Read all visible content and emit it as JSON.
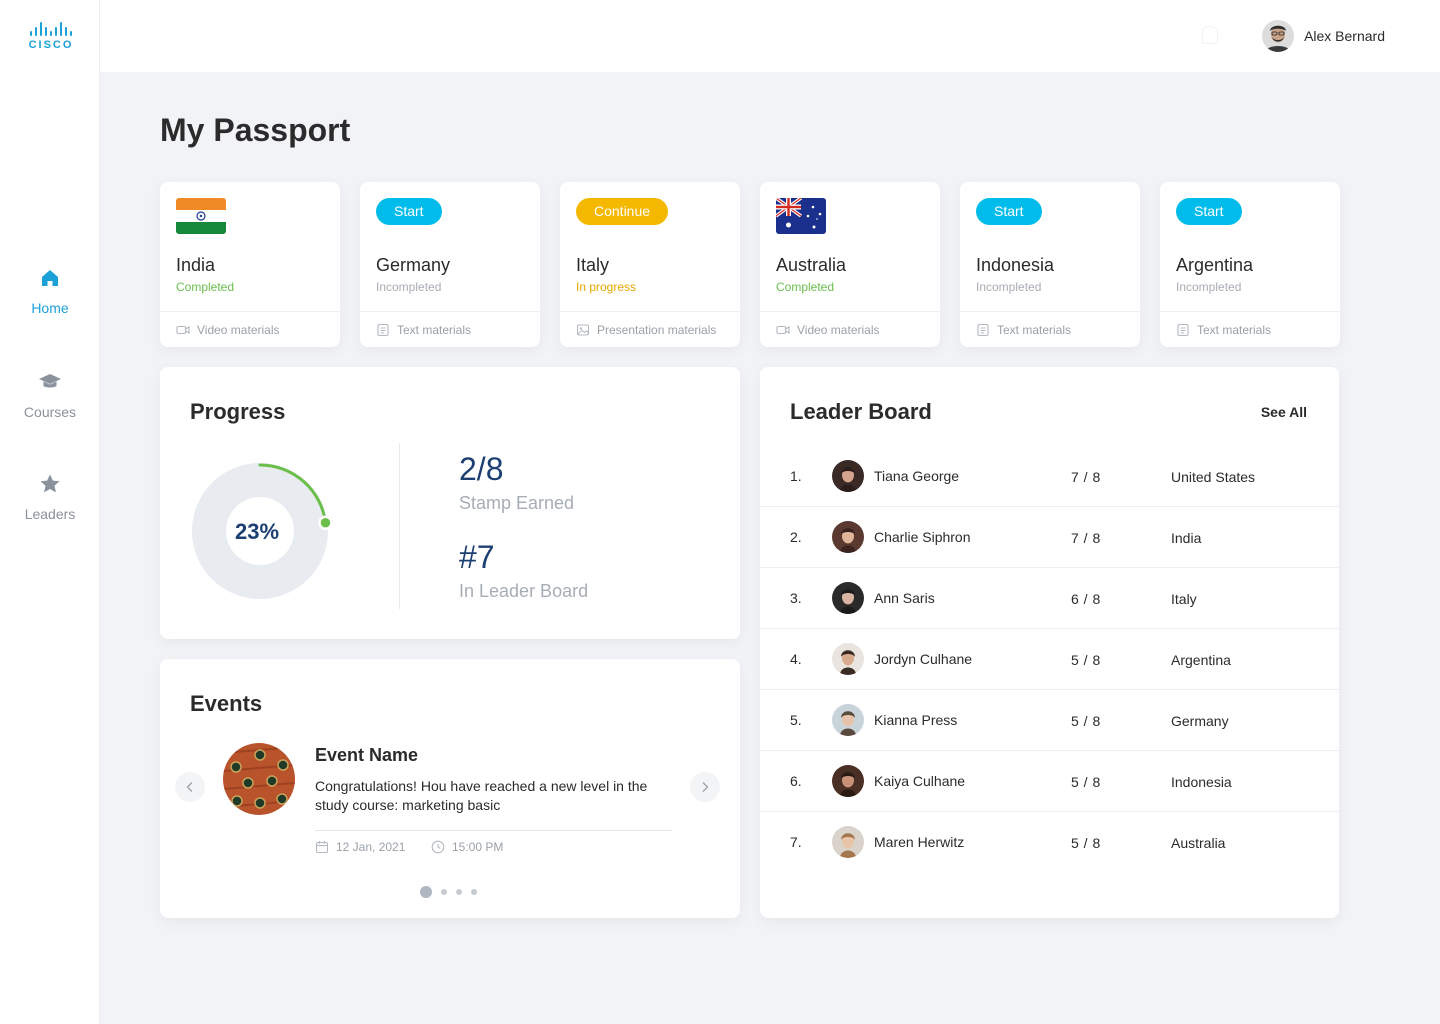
{
  "brand": {
    "name": "CISCO"
  },
  "nav": {
    "items": [
      {
        "label": "Home",
        "icon": "home-icon",
        "active": true
      },
      {
        "label": "Courses",
        "icon": "graduation-cap-icon",
        "active": false
      },
      {
        "label": "Leaders",
        "icon": "star-icon",
        "active": false
      }
    ]
  },
  "header": {
    "user_name": "Alex Bernard"
  },
  "page": {
    "title": "My Passport"
  },
  "countries": [
    {
      "name": "India",
      "status": "Completed",
      "action": "",
      "material": "Video materials"
    },
    {
      "name": "Germany",
      "status": "Incompleted",
      "action": "Start",
      "material": "Text materials"
    },
    {
      "name": "Italy",
      "status": "In progress",
      "action": "Continue",
      "material": "Presentation materials"
    },
    {
      "name": "Australia",
      "status": "Completed",
      "action": "",
      "material": "Video materials"
    },
    {
      "name": "Indonesia",
      "status": "Incompleted",
      "action": "Start",
      "material": "Text materials"
    },
    {
      "name": "Argentina",
      "status": "Incompleted",
      "action": "Start",
      "material": "Text materials"
    }
  ],
  "progress": {
    "title": "Progress",
    "percent_label": "23%",
    "percent_value": 0.23,
    "stamps": "2/8",
    "stamps_label": "Stamp Earned",
    "rank": "#7",
    "rank_label": "In Leader Board"
  },
  "events": {
    "title": "Events",
    "name": "Event Name",
    "description": "Congratulations! Hou have reached a new level in the study course: marketing basic",
    "date": "12 Jan, 2021",
    "time": "15:00 PM",
    "page_count": 4,
    "active_page": 1
  },
  "leaderboard": {
    "title": "Leader Board",
    "see_all": "See All",
    "rows": [
      {
        "rank": "1.",
        "name": "Tiana George",
        "score": "7 / 8",
        "country": "United States"
      },
      {
        "rank": "2.",
        "name": "Charlie Siphron",
        "score": "7 / 8",
        "country": "India"
      },
      {
        "rank": "3.",
        "name": "Ann Saris",
        "score": "6 / 8",
        "country": "Italy"
      },
      {
        "rank": "4.",
        "name": "Jordyn Culhane",
        "score": "5 / 8",
        "country": "Argentina"
      },
      {
        "rank": "5.",
        "name": "Kianna Press",
        "score": "5 / 8",
        "country": "Germany"
      },
      {
        "rank": "6.",
        "name": "Kaiya Culhane",
        "score": "5 / 8",
        "country": "Indonesia"
      },
      {
        "rank": "7.",
        "name": "Maren Herwitz",
        "score": "5 / 8",
        "country": "Australia"
      }
    ]
  },
  "colors": {
    "accent": "#00bceb",
    "brand": "#1ba0d7",
    "completed": "#6abf4b",
    "in_progress": "#f5b800",
    "stat_text": "#1d3f72"
  }
}
